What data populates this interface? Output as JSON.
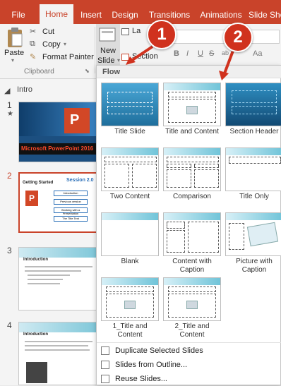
{
  "tabs": [
    {
      "label": "File",
      "active": false
    },
    {
      "label": "Home",
      "active": true
    },
    {
      "label": "Insert",
      "active": false
    },
    {
      "label": "Design",
      "active": false
    },
    {
      "label": "Transitions",
      "active": false
    },
    {
      "label": "Animations",
      "active": false
    },
    {
      "label": "Slide Sho",
      "active": false
    }
  ],
  "ribbon": {
    "paste_label": "Paste",
    "cut_label": "Cut",
    "copy_label": "Copy",
    "format_painter_label": "Format Painter",
    "clipboard_group_label": "Clipboard",
    "new_slide_label": "New",
    "new_slide_label2": "Slide",
    "layout_label": "La",
    "section_label": "Section",
    "font_buttons": [
      "B",
      "I",
      "U",
      "S",
      "ab",
      "Aa"
    ]
  },
  "thumbnail_pane": {
    "section_label": "Intro",
    "slides": [
      {
        "num": "1",
        "caption": "Microsoft PowerPoint 2016"
      },
      {
        "num": "2",
        "title": "Getting Started",
        "subtitle": "Session 2.0",
        "rows": [
          "Introduction",
          "Previous version",
          "Working with a Presentation",
          "The Title Text"
        ]
      },
      {
        "num": "3",
        "title": "Introduction"
      },
      {
        "num": "4",
        "title": "Introduction"
      }
    ]
  },
  "gallery": {
    "heading": "Flow",
    "layouts": [
      {
        "line1": "Title Slide",
        "line2": ""
      },
      {
        "line1": "Title and Content",
        "line2": ""
      },
      {
        "line1": "Section Header",
        "line2": ""
      },
      {
        "line1": "Two Content",
        "line2": ""
      },
      {
        "line1": "Comparison",
        "line2": ""
      },
      {
        "line1": "Title Only",
        "line2": ""
      },
      {
        "line1": "Blank",
        "line2": ""
      },
      {
        "line1": "Content with",
        "line2": "Caption"
      },
      {
        "line1": "Picture with",
        "line2": "Caption"
      },
      {
        "line1": "1_Title and",
        "line2": "Content"
      },
      {
        "line1": "2_Title and",
        "line2": "Content"
      }
    ],
    "menu": [
      {
        "label": "Duplicate Selected Slides",
        "icon": "duplicate-slides-icon"
      },
      {
        "label": "Slides from Outline...",
        "icon": "outline-icon"
      },
      {
        "label": "Reuse Slides...",
        "icon": "reuse-slides-icon"
      }
    ]
  },
  "callouts": [
    "1",
    "2"
  ],
  "colors": {
    "ribbon_accent": "#c9432a",
    "callout": "#d0321e",
    "selection": "#9cc3e6"
  }
}
